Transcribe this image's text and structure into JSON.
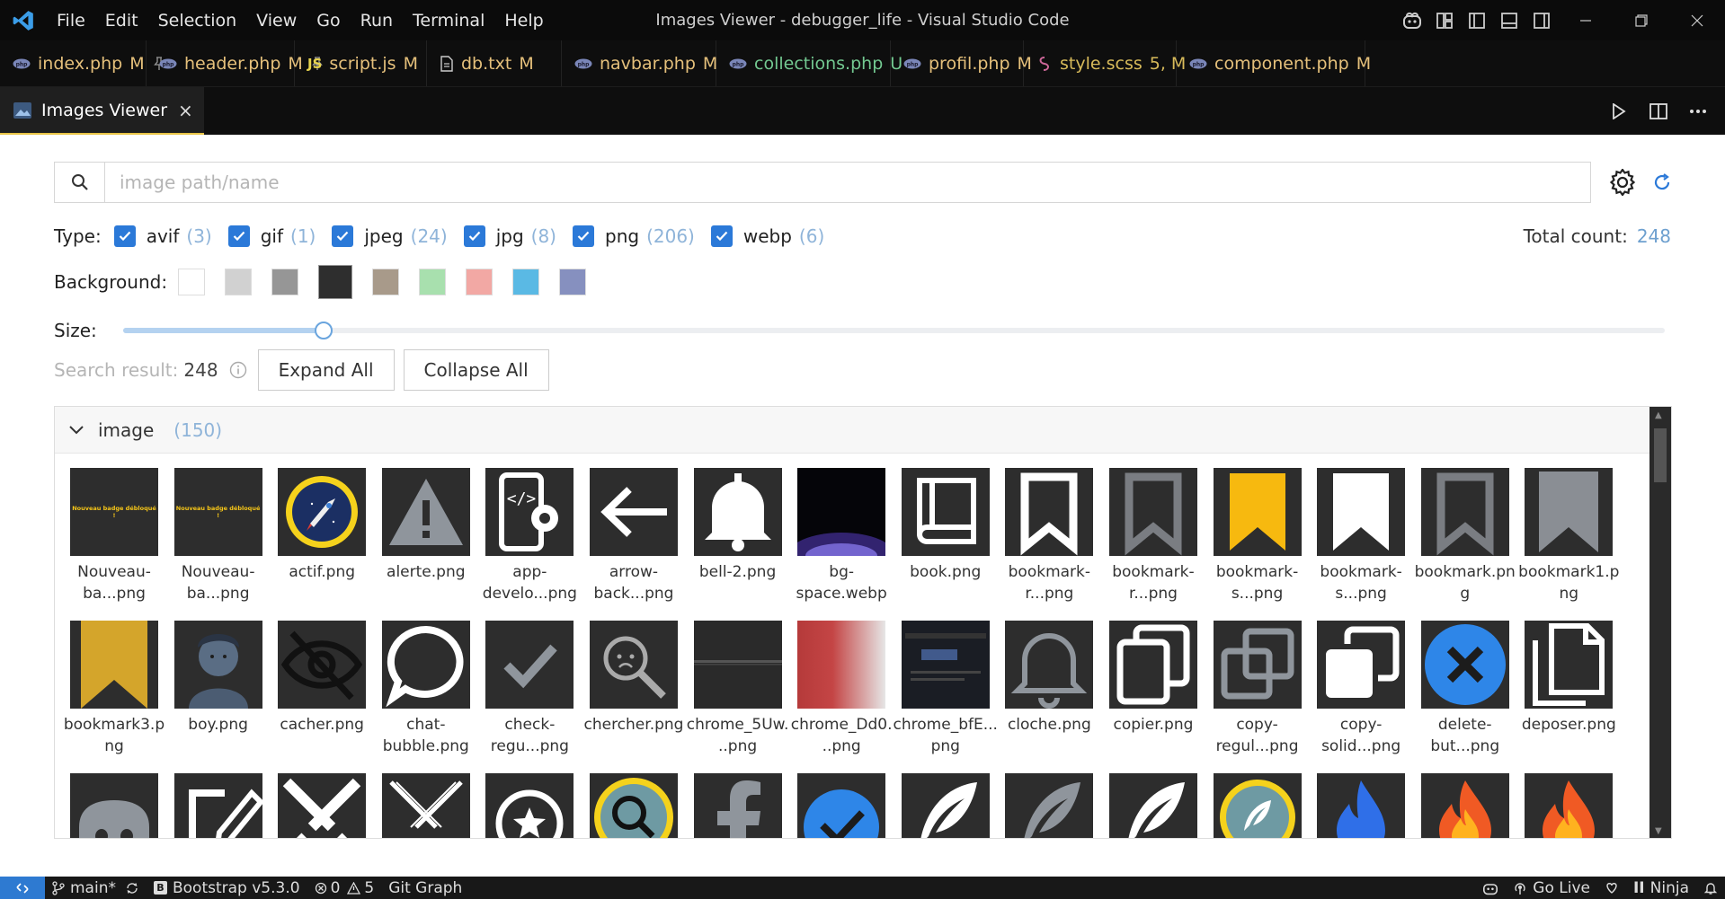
{
  "window": {
    "title": "Images Viewer - debugger_life - Visual Studio Code",
    "menu": [
      "File",
      "Edit",
      "Selection",
      "View",
      "Go",
      "Run",
      "Terminal",
      "Help"
    ]
  },
  "tabs": [
    {
      "name": "index.php",
      "status": "M",
      "icon": "php-icon",
      "pinned": true,
      "color": "#e5c07b"
    },
    {
      "name": "header.php",
      "status": "M",
      "icon": "php-icon",
      "pinned": true,
      "color": "#e5c07b"
    },
    {
      "name": "script.js",
      "status": "M",
      "icon": "js-icon",
      "pinned": false,
      "color": "#e5c07b"
    },
    {
      "name": "db.txt",
      "status": "M",
      "icon": "text-file-icon",
      "pinned": false,
      "color": "#e5c07b"
    },
    {
      "name": "navbar.php",
      "status": "M",
      "icon": "php-icon",
      "pinned": false,
      "color": "#e5c07b"
    },
    {
      "name": "collections.php",
      "status": "U",
      "icon": "php-icon",
      "pinned": false,
      "color": "#73c991"
    },
    {
      "name": "profil.php",
      "status": "M",
      "icon": "php-icon",
      "pinned": false,
      "color": "#e5c07b"
    },
    {
      "name": "style.scss",
      "status": "5, M",
      "icon": "scss-icon",
      "pinned": false,
      "color": "#d7ba5a"
    },
    {
      "name": "component.php",
      "status": "M",
      "icon": "php-icon",
      "pinned": false,
      "color": "#e5c07b"
    }
  ],
  "active_tab": {
    "label": "Images Viewer",
    "close": "×"
  },
  "search": {
    "placeholder": "image path/name",
    "value": ""
  },
  "types": {
    "label": "Type:",
    "items": [
      {
        "name": "avif",
        "count": "(3)"
      },
      {
        "name": "gif",
        "count": "(1)"
      },
      {
        "name": "jpeg",
        "count": "(24)"
      },
      {
        "name": "jpg",
        "count": "(8)"
      },
      {
        "name": "png",
        "count": "(206)"
      },
      {
        "name": "webp",
        "count": "(6)"
      }
    ],
    "total_label": "Total count:",
    "total_value": "248"
  },
  "background": {
    "label": "Background:",
    "swatches": [
      "#ffffff",
      "#d1d1d1",
      "#969696",
      "#2e2e2e",
      "#a89a8a",
      "#a8e0ae",
      "#f2a8a4",
      "#5ab9e4",
      "#8690bf"
    ],
    "selected_index": 3
  },
  "size": {
    "label": "Size:",
    "value_fraction": 0.13
  },
  "results": {
    "label": "Search result:",
    "value": "248",
    "expand_label": "Expand All",
    "collapse_label": "Collapse All"
  },
  "group": {
    "name": "image",
    "count": "(150)",
    "images": [
      {
        "name": "Nouveau-ba...png",
        "thumb": "badge-text",
        "text": "Nouveau badge débloqué !"
      },
      {
        "name": "Nouveau-ba...png",
        "thumb": "badge-text",
        "text": "Nouveau badge débloqué !"
      },
      {
        "name": "actif.png",
        "thumb": "rocket-badge"
      },
      {
        "name": "alerte.png",
        "thumb": "warning-triangle"
      },
      {
        "name": "app-develo...png",
        "thumb": "phone-gear"
      },
      {
        "name": "arrow-back...png",
        "thumb": "arrow-left"
      },
      {
        "name": "bell-2.png",
        "thumb": "bell-filled"
      },
      {
        "name": "bg-space.webp",
        "thumb": "space-glow"
      },
      {
        "name": "book.png",
        "thumb": "book"
      },
      {
        "name": "bookmark-r...png",
        "thumb": "bookmark-outline-white"
      },
      {
        "name": "bookmark-r...png",
        "thumb": "bookmark-outline-gray"
      },
      {
        "name": "bookmark-s...png",
        "thumb": "bookmark-yellow"
      },
      {
        "name": "bookmark-s...png",
        "thumb": "bookmark-white"
      },
      {
        "name": "bookmark.png",
        "thumb": "bookmark-outline-gray"
      },
      {
        "name": "bookmark1.png",
        "thumb": "bookmark-gray"
      },
      {
        "name": "bookmark3.png",
        "thumb": "bookmark-gold-big"
      },
      {
        "name": "boy.png",
        "thumb": "boy"
      },
      {
        "name": "cacher.png",
        "thumb": "eye-slash"
      },
      {
        "name": "chat-bubble.png",
        "thumb": "chat-bubble"
      },
      {
        "name": "check-regu...png",
        "thumb": "check"
      },
      {
        "name": "chercher.png",
        "thumb": "search-face"
      },
      {
        "name": "chrome_5Uw...png",
        "thumb": "chrome-dark"
      },
      {
        "name": "chrome_Dd0...png",
        "thumb": "chrome-red"
      },
      {
        "name": "chrome_bfE...png",
        "thumb": "chrome-screenshot"
      },
      {
        "name": "cloche.png",
        "thumb": "bell-outline"
      },
      {
        "name": "copier.png",
        "thumb": "copy-white"
      },
      {
        "name": "copy-regul...png",
        "thumb": "copy-gray"
      },
      {
        "name": "copy-solid...png",
        "thumb": "copy-solid"
      },
      {
        "name": "delete-but...png",
        "thumb": "delete-circle"
      },
      {
        "name": "deposer.png",
        "thumb": "files"
      },
      {
        "name": "",
        "thumb": "discord"
      },
      {
        "name": "",
        "thumb": "edit"
      },
      {
        "name": "",
        "thumb": "swords-white"
      },
      {
        "name": "",
        "thumb": "swords-outline"
      },
      {
        "name": "",
        "thumb": "star-badge"
      },
      {
        "name": "",
        "thumb": "search-yellow"
      },
      {
        "name": "",
        "thumb": "facebook"
      },
      {
        "name": "",
        "thumb": "check-circle-blue"
      },
      {
        "name": "",
        "thumb": "feather-white"
      },
      {
        "name": "",
        "thumb": "feather-gray"
      },
      {
        "name": "",
        "thumb": "feather-white"
      },
      {
        "name": "",
        "thumb": "feather-badge"
      },
      {
        "name": "",
        "thumb": "flame-blue"
      },
      {
        "name": "",
        "thumb": "flame-orange"
      },
      {
        "name": "",
        "thumb": "flame-orange"
      }
    ]
  },
  "statusbar": {
    "branch": "main*",
    "bootstrap": "Bootstrap v5.3.0",
    "errors": "0",
    "warnings": "5",
    "git_graph": "Git Graph",
    "go_live": "Go Live",
    "ninja": "Ninja"
  },
  "colors": {
    "accent": "#2b79d8",
    "tab_text": "#e5c07b",
    "count_text": "#8fb4d9"
  }
}
